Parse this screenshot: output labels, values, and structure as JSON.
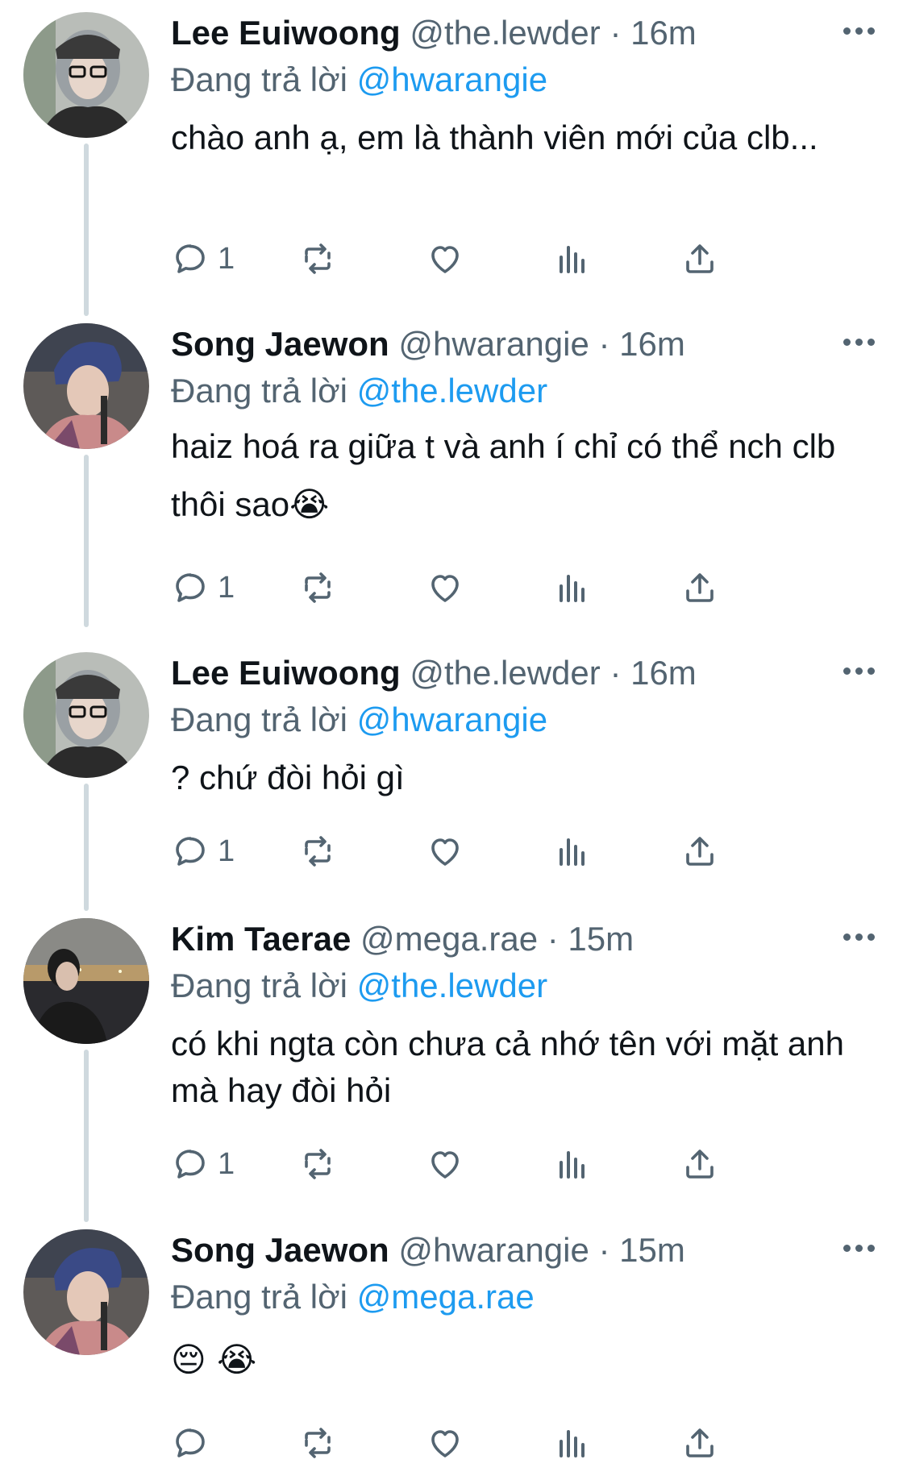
{
  "reply_prefix": "Đang trả lời",
  "more_label": "More",
  "colors": {
    "name": "#0f1419",
    "meta": "#536471",
    "mention": "#1d9bf0",
    "thread_line": "#cfd9de",
    "icon": "#536471"
  },
  "icons": {
    "reply": "reply-icon",
    "retweet": "retweet-icon",
    "like": "heart-icon",
    "views": "views-icon",
    "share": "share-icon",
    "more": "more-icon"
  },
  "tweets": [
    {
      "name": "Lee Euiwoong",
      "handle": "@the.lewder",
      "time": "· 16m",
      "reply_to": "@hwarangie",
      "text": "chào anh ạ, em là thành viên mới của clb...",
      "reply_count": "1"
    },
    {
      "name": "Song Jaewon",
      "handle": "@hwarangie",
      "time": "· 16m",
      "reply_to": "@the.lewder",
      "text": "haiz hoá ra giữa t và anh í chỉ có thể nch clb thôi sao😭",
      "reply_count": "1"
    },
    {
      "name": "Lee Euiwoong",
      "handle": "@the.lewder",
      "time": "· 16m",
      "reply_to": "@hwarangie",
      "text": "? chứ đòi hỏi gì",
      "reply_count": "1"
    },
    {
      "name": "Kim Taerae",
      "handle": "@mega.rae",
      "time": "· 15m",
      "reply_to": "@the.lewder",
      "text": "có khi ngta còn chưa cả nhớ tên với mặt anh mà hay đòi hỏi",
      "reply_count": "1"
    },
    {
      "name": "Song Jaewon",
      "handle": "@hwarangie",
      "time": "· 15m",
      "reply_to": "@mega.rae",
      "text": "😔 😭",
      "reply_count": ""
    }
  ]
}
